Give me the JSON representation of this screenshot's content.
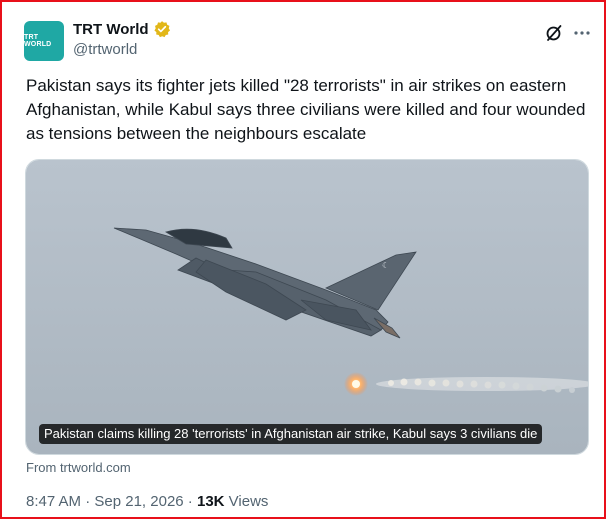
{
  "account": {
    "display_name": "TRT World",
    "handle": "@trtworld",
    "avatar_logo": "TRT WORLD",
    "avatar_color": "#1fa8a4",
    "verified_badge_color": "#e2b719"
  },
  "actions": {
    "grok_icon": "grok-icon",
    "more_icon": "more-icon"
  },
  "tweet": {
    "text": "Pakistan says its fighter jets killed \"28 terrorists\" in air strikes on eastern Afghanistan, while Kabul says three civilians were killed and four wounded as tensions between the neighbours escalate"
  },
  "card": {
    "caption": "Pakistan claims killing 28 'terrorists' in Afghanistan air strike, Kabul says 3 civilians die",
    "source": "From trtworld.com"
  },
  "meta": {
    "time": "8:47 AM",
    "separator": " · ",
    "date": "Sep 21, 2026",
    "views_count": "13K",
    "views_label": " Views"
  },
  "colors": {
    "frame_border": "#e8101a",
    "text_primary": "#0f1419",
    "text_secondary": "#536471"
  }
}
